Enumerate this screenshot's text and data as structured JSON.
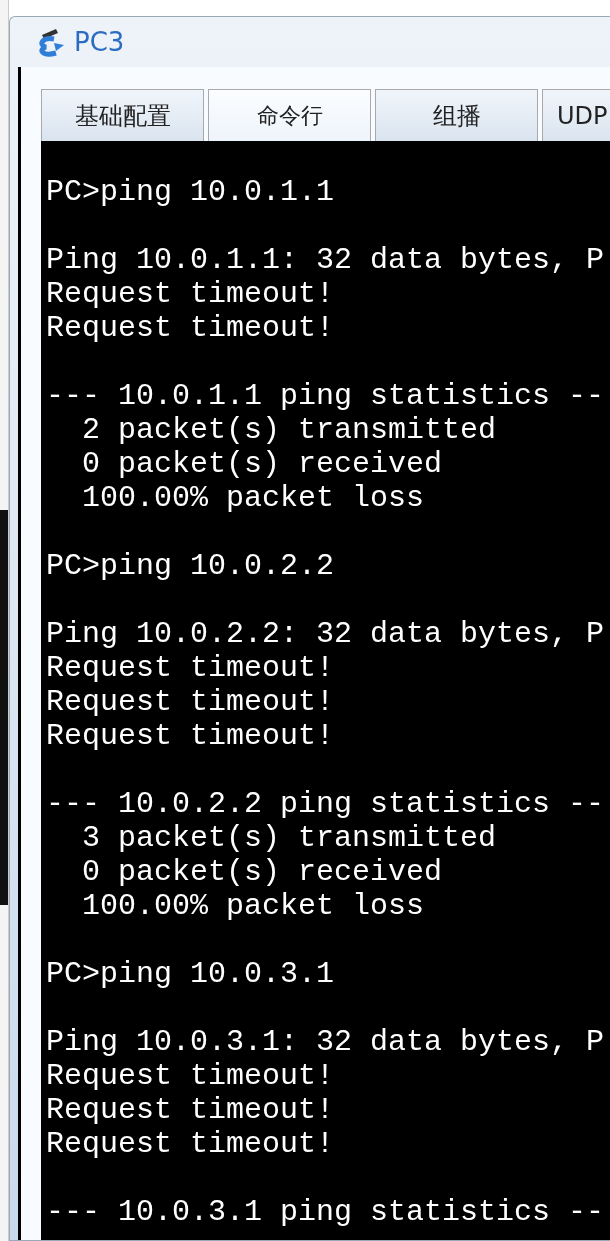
{
  "window": {
    "title": "PC3"
  },
  "tabs": [
    {
      "label": "基础配置",
      "selected": false
    },
    {
      "label": "命令行",
      "selected": true
    },
    {
      "label": "组播",
      "selected": false
    },
    {
      "label": "UDP",
      "selected": false
    }
  ],
  "terminal": {
    "blocks": [
      [
        "PC>ping 10.0.1.1"
      ],
      [
        "Ping 10.0.1.1: 32 data bytes, P",
        "Request timeout!",
        "Request timeout!"
      ],
      [
        "--- 10.0.1.1 ping statistics --",
        "  2 packet(s) transmitted",
        "  0 packet(s) received",
        "  100.00% packet loss"
      ],
      [
        "PC>ping 10.0.2.2"
      ],
      [
        "Ping 10.0.2.2: 32 data bytes, P",
        "Request timeout!",
        "Request timeout!",
        "Request timeout!"
      ],
      [
        "--- 10.0.2.2 ping statistics --",
        "  3 packet(s) transmitted",
        "  0 packet(s) received",
        "  100.00% packet loss"
      ],
      [
        "PC>ping 10.0.3.1"
      ],
      [
        "Ping 10.0.3.1: 32 data bytes, P",
        "Request timeout!",
        "Request timeout!",
        "Request timeout!"
      ],
      [
        "--- 10.0.3.1 ping statistics --"
      ]
    ]
  }
}
